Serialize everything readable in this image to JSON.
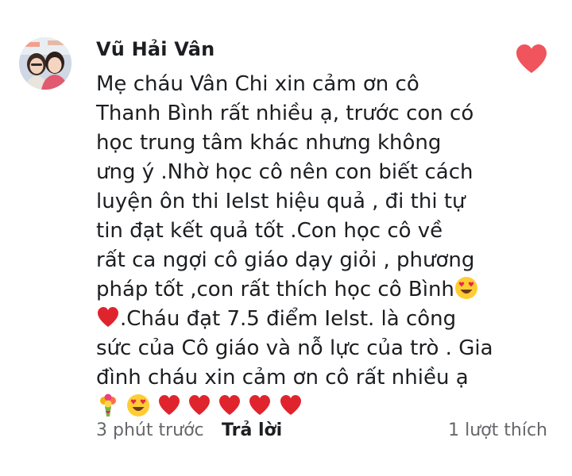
{
  "comment": {
    "author": "Vũ Hải Vân",
    "lines": [
      "Mẹ cháu Vân Chi xin cảm ơn cô",
      "Thanh Bình rất nhiều ạ, trước con có",
      "học trung tâm khác nhưng không",
      "ưng ý .Nhờ học cô nên con biết cách",
      "luyện ôn thi Ielst hiệu quả , đi thi tự",
      "tin đạt kết quả tốt .Con học cô về",
      "rất ca ngợi cô giáo dạy giỏi , phương",
      "pháp tốt ,con rất thích học cô Bình",
      ".Cháu đạt 7.5 điểm Ielst. là công",
      "sức của Cô giáo và nỗ lực của trò . Gia",
      "đình cháu xin cảm ơn cô rất nhiều ạ"
    ],
    "emojis": {
      "after_line_8": "heart-eyes-emoji",
      "before_line_9": "red-heart-emoji",
      "last_row": [
        "bouquet-emoji",
        "heart-eyes-emoji",
        "red-heart-emoji",
        "red-heart-emoji",
        "red-heart-emoji",
        "red-heart-emoji",
        "red-heart-emoji"
      ]
    },
    "footer": {
      "time": "3 phút trước",
      "reply": "Trả lời",
      "likes": "1 lượt thích"
    }
  },
  "colors": {
    "text": "#1c1e21",
    "muted": "#65676b",
    "heart": "#f0545c"
  }
}
